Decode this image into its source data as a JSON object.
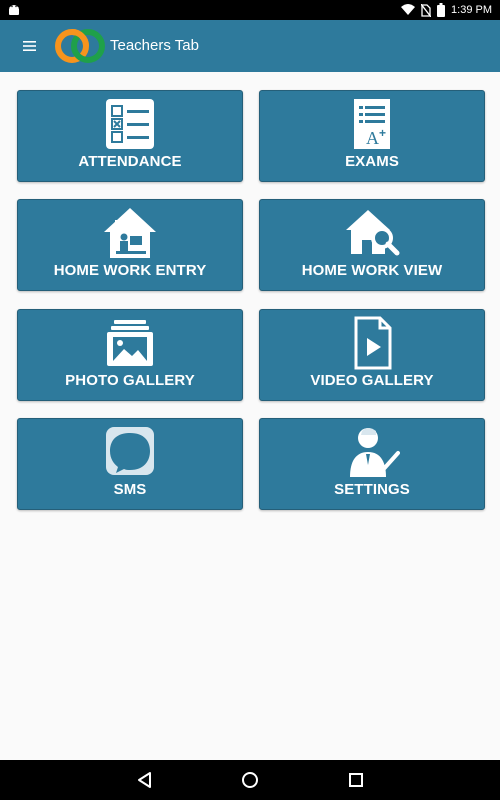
{
  "status_bar": {
    "time": "1:39 PM",
    "icons": [
      "android-icon",
      "wifi-icon",
      "no-sim-icon",
      "battery-icon"
    ]
  },
  "app_bar": {
    "title": "Teachers Tab",
    "menu_icon": "hamburger-menu-icon"
  },
  "colors": {
    "primary": "#2e7a9c",
    "background": "#fafafa",
    "logo_orange": "#f7941d",
    "logo_green": "#1fa04a"
  },
  "tiles": [
    {
      "label": "ATTENDANCE",
      "icon": "checklist-icon"
    },
    {
      "label": "EXAMS",
      "icon": "exam-paper-icon"
    },
    {
      "label": "HOME WORK ENTRY",
      "icon": "home-study-icon"
    },
    {
      "label": "HOME WORK VIEW",
      "icon": "home-search-icon"
    },
    {
      "label": "PHOTO GALLERY",
      "icon": "photo-album-icon"
    },
    {
      "label": "VIDEO GALLERY",
      "icon": "video-file-icon"
    },
    {
      "label": "SMS",
      "icon": "chat-bubble-icon"
    },
    {
      "label": "SETTINGS",
      "icon": "user-check-icon"
    }
  ],
  "nav_bar": {
    "buttons": [
      "back-icon",
      "home-icon",
      "recents-icon"
    ]
  }
}
